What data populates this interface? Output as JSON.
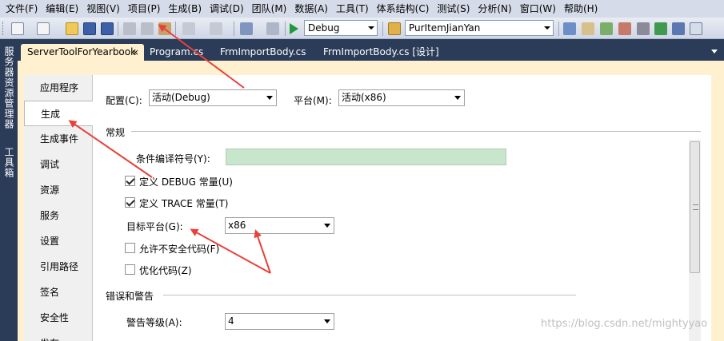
{
  "menu": [
    "文件(F)",
    "编辑(E)",
    "视图(V)",
    "项目(P)",
    "生成(B)",
    "调试(D)",
    "团队(M)",
    "数据(A)",
    "工具(T)",
    "体系结构(C)",
    "测试(S)",
    "分析(N)",
    "窗口(W)",
    "帮助(H)"
  ],
  "toolbar": {
    "config_combo": "Debug",
    "find_combo": "PurItemJianYan"
  },
  "side_windows": [
    "服务器资源管理器",
    "工具箱"
  ],
  "doc_tabs": [
    "ServerToolForYearbook",
    "Program.cs",
    "FrmImportBody.cs",
    "FrmImportBody.cs [设计]"
  ],
  "doc_tab_close": "×",
  "nav": [
    "应用程序",
    "生成",
    "生成事件",
    "调试",
    "资源",
    "服务",
    "设置",
    "引用路径",
    "签名",
    "安全性",
    "发布"
  ],
  "page": {
    "config_label": "配置(C):",
    "config_value": "活动(Debug)",
    "platform_label": "平台(M):",
    "platform_value": "活动(x86)",
    "general_heading": "常规",
    "conditional_label": "条件编译符号(Y):",
    "conditional_value": "",
    "define_debug": "定义 DEBUG 常量(U)",
    "define_trace": "定义 TRACE 常量(T)",
    "target_label": "目标平台(G):",
    "target_value": "x86",
    "allow_unsafe": "允许不安全代码(F)",
    "optimize": "优化代码(Z)",
    "errors_heading": "错误和警告",
    "warning_label": "警告等级(A):",
    "warning_value": "4"
  },
  "watermark": "https://blog.csdn.net/mightyyao",
  "colors": {
    "accent_selected_tab": "#fff1cf",
    "annotation": "#e8413b",
    "chrome": "#2b3c59"
  }
}
